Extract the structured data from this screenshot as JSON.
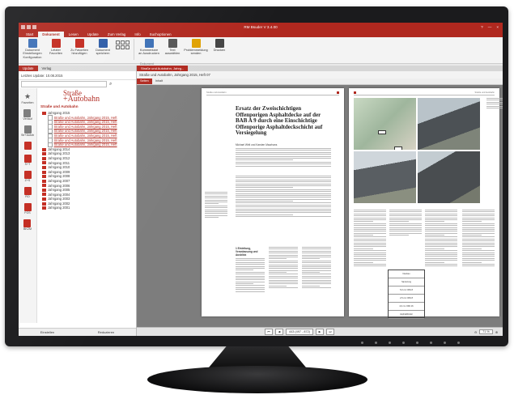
{
  "app": {
    "title": "RM Bsuder V 3.4.00",
    "window_controls": [
      "?",
      "—",
      "×"
    ]
  },
  "menu_tabs": [
    "Start",
    "Dokument",
    "Lesen",
    "Update",
    "Zum Verlag",
    "Info",
    "Suchoptionen"
  ],
  "ribbon": {
    "buttons": [
      {
        "label": "Dokument Einstellungen Konfiguration",
        "icon": "settings-doc-icon",
        "color": "#3b6fb6"
      },
      {
        "label": "Letzter Favoriten",
        "icon": "star-list-icon",
        "color": "#c2271c"
      },
      {
        "label": "Zu Favoriten hinzufügen",
        "icon": "add-favorite-icon",
        "color": "#c2271c"
      },
      {
        "label": "Dokument speichern",
        "icon": "save-icon",
        "color": "#2b5aa6"
      },
      {
        "label": "Kommentare an Ausdrucken",
        "icon": "comment-icon",
        "color": "#3b6fb6"
      },
      {
        "label": "Text auswählen",
        "icon": "text-select-icon",
        "color": "#555555"
      },
      {
        "label": "Problemmeldung senden",
        "icon": "warning-icon",
        "color": "#e0a100"
      },
      {
        "label": "Drucken",
        "icon": "print-icon",
        "color": "#444444"
      }
    ],
    "group_label": "Dokument"
  },
  "left_panel": {
    "tabs": [
      "Update",
      "Verlag"
    ],
    "last_update": "Letztes Update: 10.08.2015",
    "search_placeholder": "",
    "logo_line1": "Straße",
    "logo_line2": "+Autobahn",
    "tree_title": "Straße und Autobahn",
    "nav_icons": [
      {
        "label": "Favoriten",
        "icon": "star-icon"
      },
      {
        "label": "Verlauf",
        "icon": "history-icon"
      },
      {
        "label": "Str+Autob",
        "icon": "book-icon"
      },
      {
        "label": "Nav",
        "icon": "nav-icon"
      },
      {
        "label": "S+T",
        "icon": "book-icon"
      },
      {
        "label": "Z+S",
        "icon": "book-icon"
      },
      {
        "label": "RO",
        "icon": "book-icon"
      },
      {
        "label": "FGS",
        "icon": "book-icon"
      },
      {
        "label": "BKZM",
        "icon": "book-icon"
      }
    ],
    "tree": [
      {
        "label": "Jahrgang 2015",
        "type": "folder",
        "level": 1
      },
      {
        "label": "Straße und Autobahn, Jahrgang 2015, Heft",
        "type": "doc",
        "level": 2
      },
      {
        "label": "Straße und Autobahn, Jahrgang 2015, Heft",
        "type": "doc",
        "level": 2
      },
      {
        "label": "Straße und Autobahn, Jahrgang 2015, Heft",
        "type": "doc",
        "level": 2
      },
      {
        "label": "Straße und Autobahn, Jahrgang 2015, Heft",
        "type": "doc",
        "level": 2
      },
      {
        "label": "Straße und Autobahn, Jahrgang 2015, Heft",
        "type": "doc",
        "level": 2
      },
      {
        "label": "Straße und Autobahn, Jahrgang 2015, Heft",
        "type": "doc",
        "level": 2
      },
      {
        "label": "Straße und Autobahn, Jahrgang 2015, Heft",
        "type": "doc",
        "level": 2
      },
      {
        "label": "Jahrgang 2014",
        "type": "folder",
        "level": 1
      },
      {
        "label": "Jahrgang 2013",
        "type": "folder",
        "level": 1
      },
      {
        "label": "Jahrgang 2012",
        "type": "folder",
        "level": 1
      },
      {
        "label": "Jahrgang 2011",
        "type": "folder",
        "level": 1
      },
      {
        "label": "Jahrgang 2010",
        "type": "folder",
        "level": 1
      },
      {
        "label": "Jahrgang 2009",
        "type": "folder",
        "level": 1
      },
      {
        "label": "Jahrgang 2008",
        "type": "folder",
        "level": 1
      },
      {
        "label": "Jahrgang 2007",
        "type": "folder",
        "level": 1
      },
      {
        "label": "Jahrgang 2006",
        "type": "folder",
        "level": 1
      },
      {
        "label": "Jahrgang 2005",
        "type": "folder",
        "level": 1
      },
      {
        "label": "Jahrgang 2004",
        "type": "folder",
        "level": 1
      },
      {
        "label": "Jahrgang 2003",
        "type": "folder",
        "level": 1
      },
      {
        "label": "Jahrgang 2002",
        "type": "folder",
        "level": 1
      },
      {
        "label": "Jahrgang 2001",
        "type": "folder",
        "level": 1
      }
    ],
    "footer": [
      "Einstellen",
      "Reduzieren"
    ]
  },
  "document": {
    "tab": "Straße und Autobahn, Jahrg...",
    "breadcrumb": "Straße und Autobahn, Jahrgang 2015, Heft 07",
    "subtabs": [
      "Seiten",
      "Inhalt"
    ],
    "article_title": "Ersatz der Zweischichtigen Offenporigen Asphaltdecke auf der BAB A 9 durch eine Einschichtige Offenporige Asphaltdeckschicht auf Versiegelung",
    "authors": "Michael Wirtl und Karsten Maurhans",
    "section_heading": "1 Einleitung, Veranlassung und Ausblick",
    "header_left": "Straße und Autobahn",
    "table_rows": [
      "Neubau",
      "Sanierung",
      "5,0 cm OPA 8",
      "2,5 cm OPA 8",
      "4,0 cm OPA 16",
      "Asphaltbinder"
    ],
    "pager_value": "443 (497 - 872)",
    "zoom_value": "71 %"
  }
}
